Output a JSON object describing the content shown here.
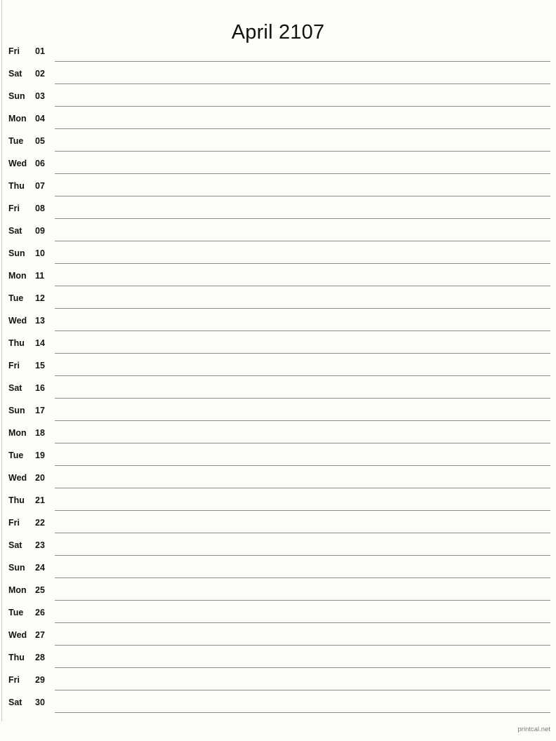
{
  "page": {
    "title": "April 2107",
    "background_color": "#fdfdfa",
    "rule_color": "#8a8a85",
    "text_color": "#141414"
  },
  "calendar": {
    "month": "April",
    "year": "2107",
    "days": [
      {
        "weekday": "Fri",
        "date": "01"
      },
      {
        "weekday": "Sat",
        "date": "02"
      },
      {
        "weekday": "Sun",
        "date": "03"
      },
      {
        "weekday": "Mon",
        "date": "04"
      },
      {
        "weekday": "Tue",
        "date": "05"
      },
      {
        "weekday": "Wed",
        "date": "06"
      },
      {
        "weekday": "Thu",
        "date": "07"
      },
      {
        "weekday": "Fri",
        "date": "08"
      },
      {
        "weekday": "Sat",
        "date": "09"
      },
      {
        "weekday": "Sun",
        "date": "10"
      },
      {
        "weekday": "Mon",
        "date": "11"
      },
      {
        "weekday": "Tue",
        "date": "12"
      },
      {
        "weekday": "Wed",
        "date": "13"
      },
      {
        "weekday": "Thu",
        "date": "14"
      },
      {
        "weekday": "Fri",
        "date": "15"
      },
      {
        "weekday": "Sat",
        "date": "16"
      },
      {
        "weekday": "Sun",
        "date": "17"
      },
      {
        "weekday": "Mon",
        "date": "18"
      },
      {
        "weekday": "Tue",
        "date": "19"
      },
      {
        "weekday": "Wed",
        "date": "20"
      },
      {
        "weekday": "Thu",
        "date": "21"
      },
      {
        "weekday": "Fri",
        "date": "22"
      },
      {
        "weekday": "Sat",
        "date": "23"
      },
      {
        "weekday": "Sun",
        "date": "24"
      },
      {
        "weekday": "Mon",
        "date": "25"
      },
      {
        "weekday": "Tue",
        "date": "26"
      },
      {
        "weekday": "Wed",
        "date": "27"
      },
      {
        "weekday": "Thu",
        "date": "28"
      },
      {
        "weekday": "Fri",
        "date": "29"
      },
      {
        "weekday": "Sat",
        "date": "30"
      }
    ]
  },
  "footer": {
    "credit": "printcal.net"
  }
}
